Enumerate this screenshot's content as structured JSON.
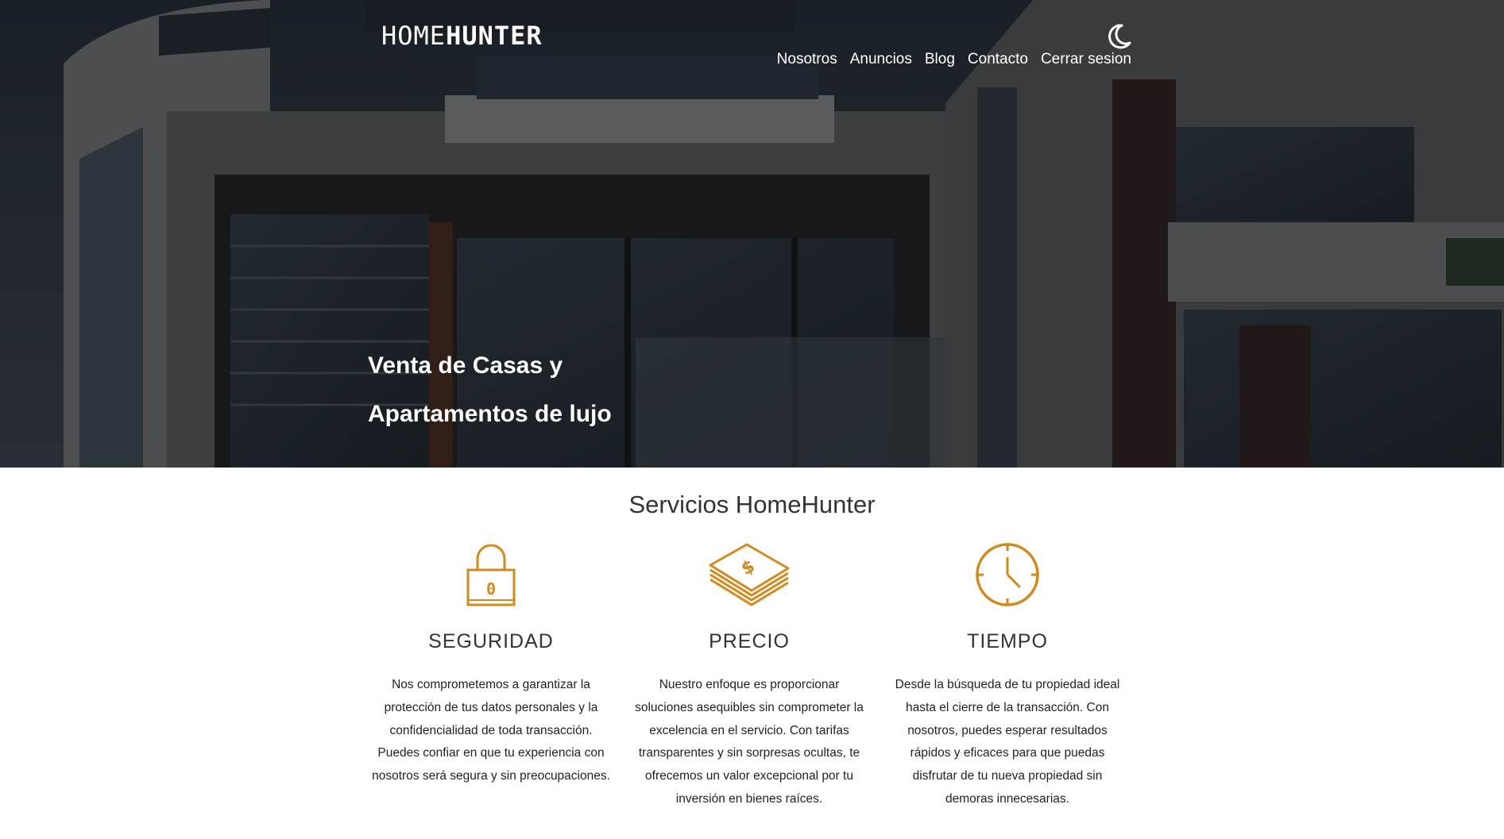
{
  "header": {
    "logo_home": "HOME",
    "logo_hunter": "HUNTER",
    "theme_toggle_icon": "moon-icon",
    "nav": [
      {
        "label": "Nosotros"
      },
      {
        "label": "Anuncios"
      },
      {
        "label": "Blog"
      },
      {
        "label": "Contacto"
      },
      {
        "label": "Cerrar sesion"
      }
    ]
  },
  "hero": {
    "title_line1": "Venta de Casas y",
    "title_line2": "Apartamentos de lujo"
  },
  "services": {
    "title": "Servicios HomeHunter",
    "accent_color": "#d4891a",
    "items": [
      {
        "icon": "lock-icon",
        "heading": "SEGURIDAD",
        "text": "Nos comprometemos a garantizar la protección de tus datos personales y la confidencialidad de toda transacción. Puedes confiar en que tu experiencia con nosotros será segura y sin preocupaciones."
      },
      {
        "icon": "money-stack-icon",
        "heading": "PRECIO",
        "text": "Nuestro enfoque es proporcionar soluciones asequibles sin comprometer la excelencia en el servicio. Con tarifas transparentes y sin sorpresas ocultas, te ofrecemos un valor excepcional por tu inversión en bienes raíces."
      },
      {
        "icon": "clock-icon",
        "heading": "TIEMPO",
        "text": "Desde la búsqueda de tu propiedad ideal hasta el cierre de la transacción. Con nosotros, puedes esperar resultados rápidos y eficaces para que puedas disfrutar de tu nueva propiedad sin demoras innecesarias."
      }
    ]
  }
}
